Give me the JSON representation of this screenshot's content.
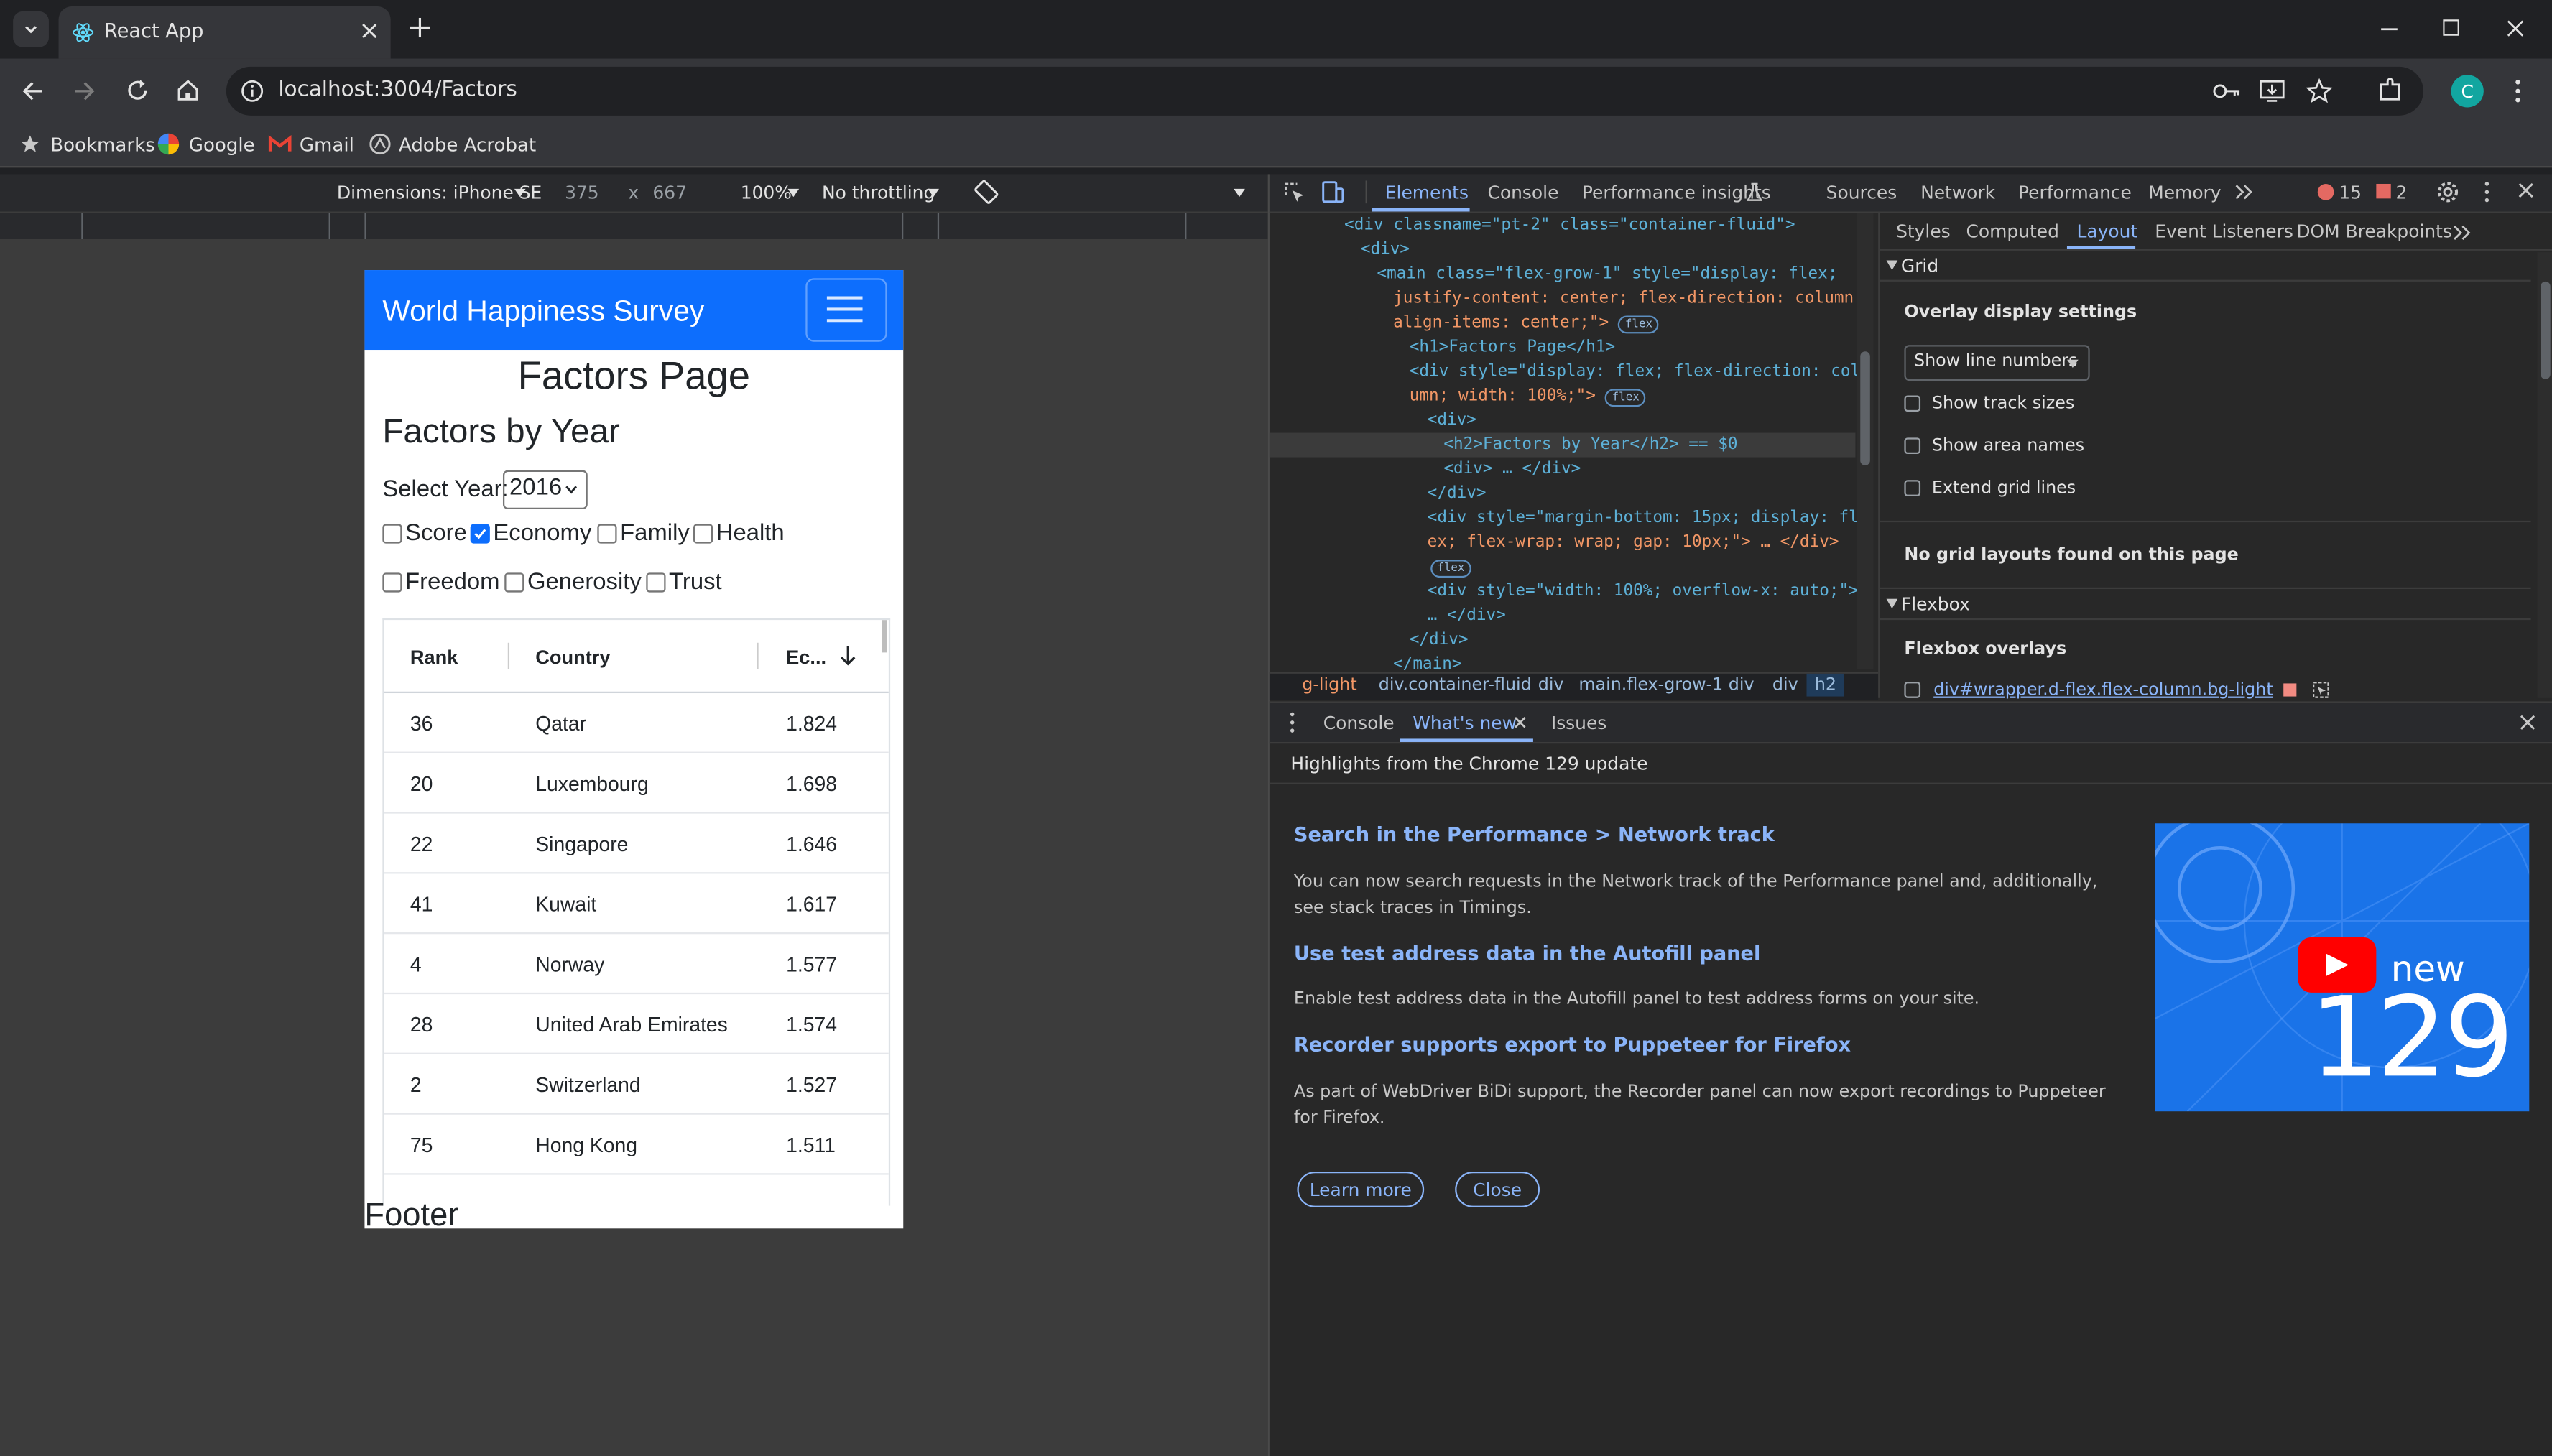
{
  "browser": {
    "tab_title": "React App",
    "url": "localhost:3004/Factors",
    "bookmarks": [
      "Bookmarks",
      "Google",
      "Gmail",
      "Adobe Acrobat"
    ],
    "profile_initial": "C"
  },
  "device_toolbar": {
    "dimensions": "Dimensions: iPhone SE",
    "width": "375",
    "times": "x",
    "height": "667",
    "zoom": "100%",
    "throttling": "No throttling"
  },
  "app": {
    "brand": "World Happiness Survey",
    "page_title": "Factors Page",
    "section_title": "Factors by Year",
    "year_label": "Select Year:",
    "year_value": "2016",
    "checkboxes": [
      {
        "label": "Score",
        "checked": false
      },
      {
        "label": "Economy",
        "checked": true
      },
      {
        "label": "Family",
        "checked": false
      },
      {
        "label": "Health",
        "checked": false
      },
      {
        "label": "Freedom",
        "checked": false
      },
      {
        "label": "Generosity",
        "checked": false
      },
      {
        "label": "Trust",
        "checked": false
      }
    ],
    "table": {
      "headers": [
        "Rank",
        "Country",
        "Ec..."
      ],
      "rows": [
        [
          "36",
          "Qatar",
          "1.824"
        ],
        [
          "20",
          "Luxembourg",
          "1.698"
        ],
        [
          "22",
          "Singapore",
          "1.646"
        ],
        [
          "41",
          "Kuwait",
          "1.617"
        ],
        [
          "4",
          "Norway",
          "1.577"
        ],
        [
          "28",
          "United Arab Emirates",
          "1.574"
        ],
        [
          "2",
          "Switzerland",
          "1.527"
        ],
        [
          "75",
          "Hong Kong",
          "1.511"
        ]
      ]
    },
    "footer": "Footer"
  },
  "devtools": {
    "tabs": [
      "Elements",
      "Console",
      "Performance insights",
      "Sources",
      "Network",
      "Performance",
      "Memory"
    ],
    "error_count": "15",
    "warning_count": "2",
    "elements_lines": [
      "<div classname=\"pt-2\" class=\"container-fluid\">",
      "<div>",
      "<main class=\"flex-grow-1\" style=\"display: flex;",
      "justify-content: center; flex-direction: column;",
      "align-items: center;\">",
      "<h1>Factors Page</h1>",
      "<div style=\"display: flex; flex-direction: col",
      "umn; width: 100%;\">",
      "<div>",
      "<h2>Factors by Year</h2> == $0",
      "<div> … </div>",
      "</div>",
      "<div style=\"margin-bottom: 15px; display: fl",
      "ex; flex-wrap: wrap; gap: 10px;\"> … </div>",
      "<div style=\"width: 100%; overflow-x: auto;\">",
      "… </div>",
      "</div>",
      "</main>"
    ],
    "flex_badge": "flex",
    "breadcrumbs": [
      "g-light",
      "div.container-fluid",
      "div",
      "main.flex-grow-1",
      "div",
      "div",
      "h2"
    ],
    "side_tabs": [
      "Styles",
      "Computed",
      "Layout",
      "Event Listeners",
      "DOM Breakpoints"
    ],
    "grid_section": "Grid",
    "overlay_settings": "Overlay display settings",
    "show_line_numbers": "Show line numbers",
    "grid_options": [
      "Show track sizes",
      "Show area names",
      "Extend grid lines"
    ],
    "no_grid": "No grid layouts found on this page",
    "flexbox_section": "Flexbox",
    "flexbox_overlays": "Flexbox overlays",
    "flex_item": "div#wrapper.d-flex.flex-column.bg-light",
    "drawer_tabs": [
      "Console",
      "What's new",
      "Issues"
    ],
    "highlights": "Highlights from the Chrome 129 update",
    "features": [
      {
        "title": "Search in the Performance > Network track",
        "desc": "You can now search requests in the Network track of the Performance panel and, additionally, see stack traces in Timings."
      },
      {
        "title": "Use test address data in the Autofill panel",
        "desc": "Enable test address data in the Autofill panel to test address forms on your site."
      },
      {
        "title": "Recorder supports export to Puppeteer for Firefox",
        "desc": "As part of WebDriver BiDi support, the Recorder panel can now export recordings to Puppeteer for Firefox."
      }
    ],
    "learn_more": "Learn more",
    "close": "Close",
    "promo_new": "new",
    "promo_version": "129"
  }
}
